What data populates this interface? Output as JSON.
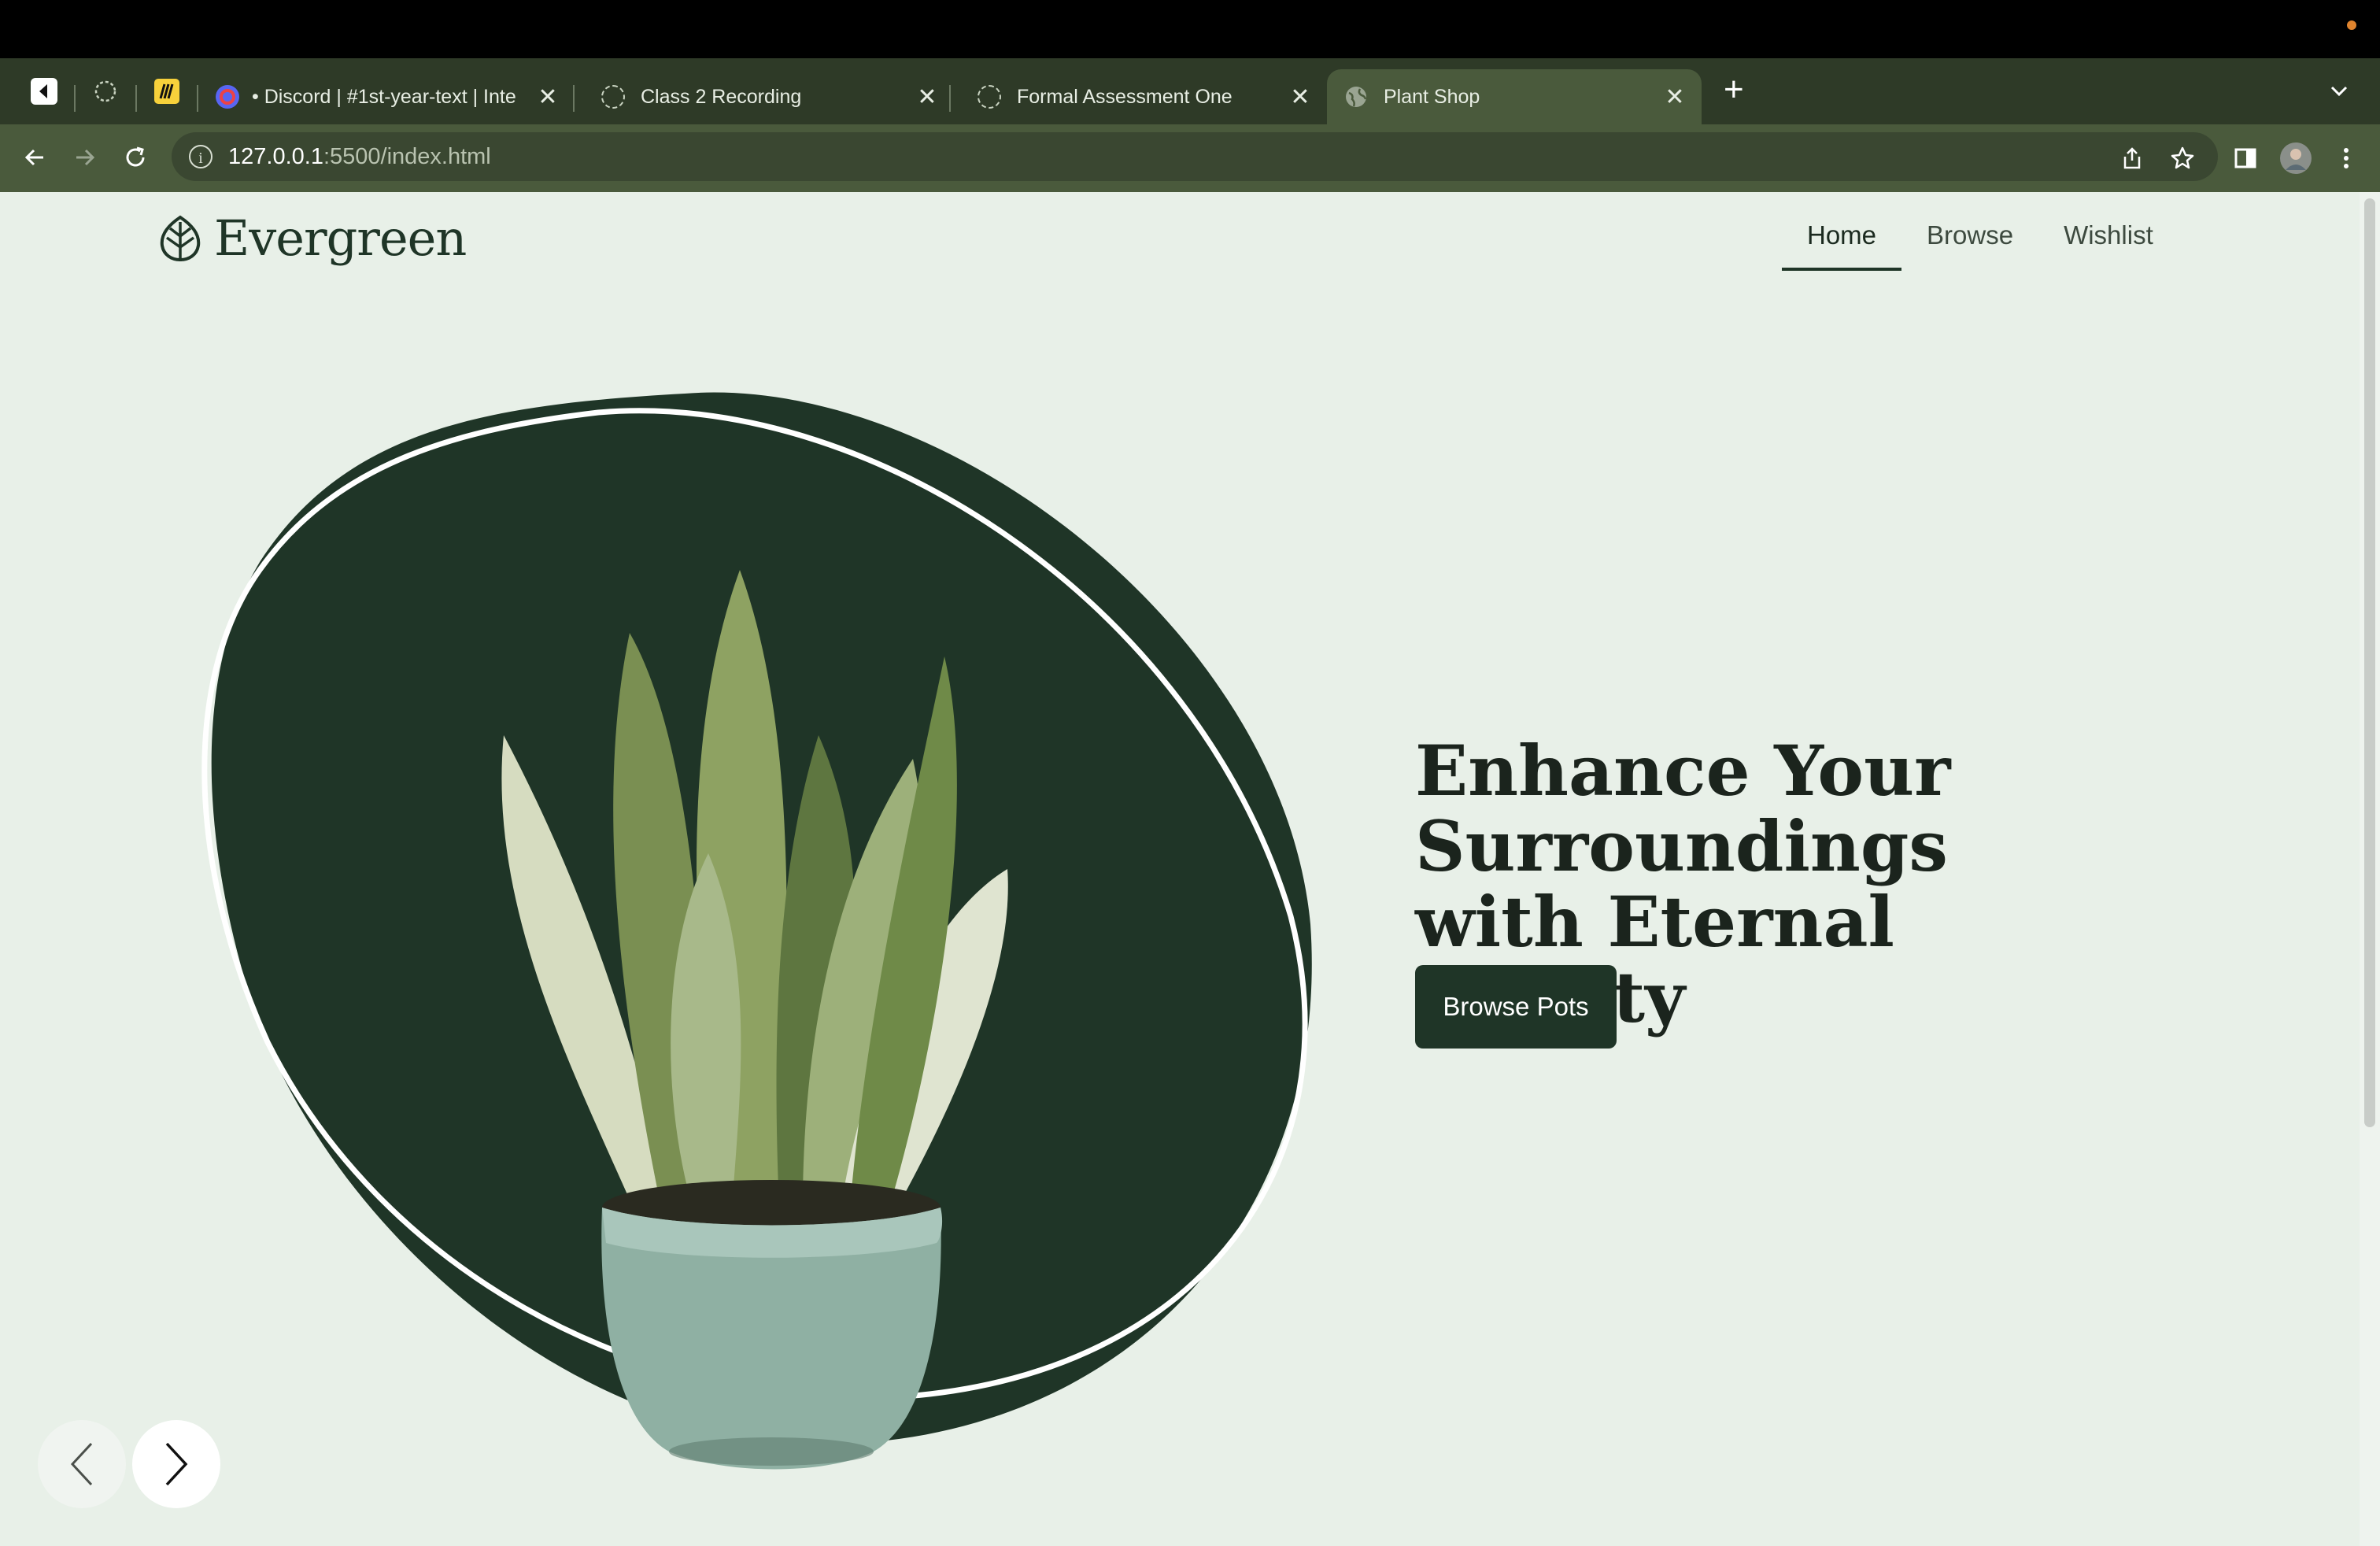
{
  "browser": {
    "tabs": [
      {
        "label": "• Discord | #1st-year-text | Inte",
        "icon": "discord-icon"
      },
      {
        "label": "Class 2 Recording",
        "icon": "loading-icon"
      },
      {
        "label": "Formal Assessment One",
        "icon": "loading-icon"
      },
      {
        "label": "Plant Shop",
        "icon": "globe-icon",
        "active": true
      }
    ],
    "close_glyph": "✕",
    "new_tab_glyph": "+",
    "url_host": "127.0.0.1",
    "url_path": ":5500/index.html"
  },
  "site": {
    "brand": "Evergreen",
    "nav": [
      {
        "label": "Home",
        "active": true
      },
      {
        "label": "Browse"
      },
      {
        "label": "Wishlist"
      }
    ],
    "hero": {
      "title": "Enhance Your Surroundings with Eternal Beauty",
      "cta": "Browse Pots"
    }
  },
  "colors": {
    "chrome_tabstrip": "#2e3a27",
    "chrome_toolbar": "#4a5a3c",
    "page_bg": "#e8f0e8",
    "brand_dark": "#1f3527"
  }
}
